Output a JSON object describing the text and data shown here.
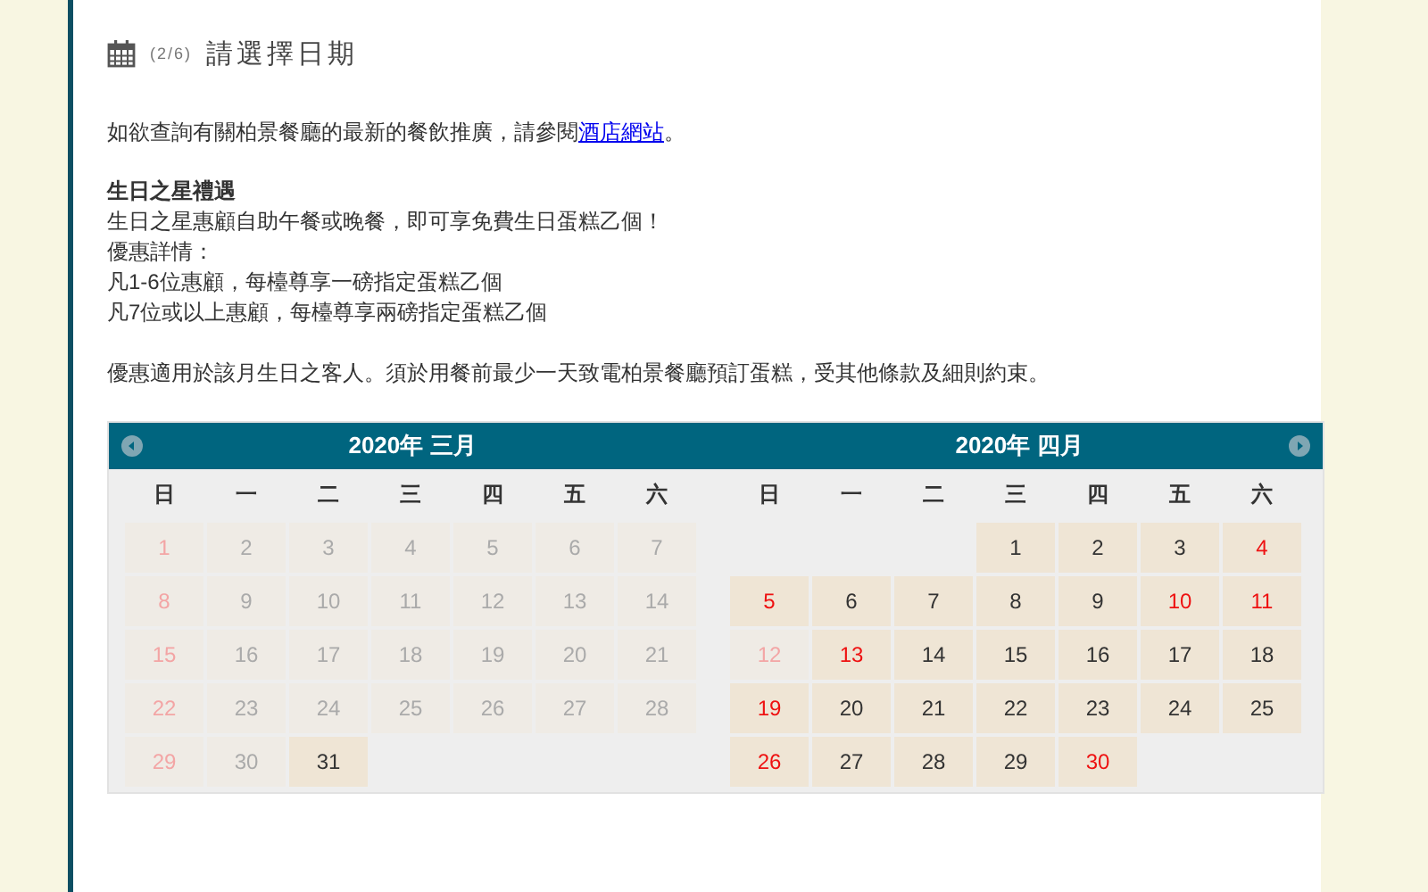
{
  "header": {
    "step": "(2/6)",
    "title": "請選擇日期"
  },
  "intro": {
    "before": "如欲查詢有關柏景餐廳的最新的餐飲推廣，請參閱",
    "link": "酒店網站",
    "after": "。"
  },
  "offer": {
    "heading": "生日之星禮遇",
    "lines": [
      "生日之星惠顧自助午餐或晚餐，即可享免費生日蛋糕乙個！",
      "優惠詳情：",
      "凡1-6位惠顧，每檯尊享一磅指定蛋糕乙個",
      "凡7位或以上惠顧，每檯尊享兩磅指定蛋糕乙個"
    ]
  },
  "note": "優惠適用於該月生日之客人。須於用餐前最少一天致電柏景餐廳預訂蛋糕，受其他條款及細則約束。",
  "months": [
    {
      "title": "2020年 三月",
      "prev_arrow": true,
      "next_arrow": false,
      "weekdays": [
        "日",
        "一",
        "二",
        "三",
        "四",
        "五",
        "六"
      ],
      "weeks": [
        [
          {
            "day": "1",
            "disabled": true,
            "holiday": true
          },
          {
            "day": "2",
            "disabled": true,
            "holiday": false
          },
          {
            "day": "3",
            "disabled": true,
            "holiday": false
          },
          {
            "day": "4",
            "disabled": true,
            "holiday": false
          },
          {
            "day": "5",
            "disabled": true,
            "holiday": false
          },
          {
            "day": "6",
            "disabled": true,
            "holiday": false
          },
          {
            "day": "7",
            "disabled": true,
            "holiday": false
          }
        ],
        [
          {
            "day": "8",
            "disabled": true,
            "holiday": true
          },
          {
            "day": "9",
            "disabled": true,
            "holiday": false
          },
          {
            "day": "10",
            "disabled": true,
            "holiday": false
          },
          {
            "day": "11",
            "disabled": true,
            "holiday": false
          },
          {
            "day": "12",
            "disabled": true,
            "holiday": false
          },
          {
            "day": "13",
            "disabled": true,
            "holiday": false
          },
          {
            "day": "14",
            "disabled": true,
            "holiday": false
          }
        ],
        [
          {
            "day": "15",
            "disabled": true,
            "holiday": true
          },
          {
            "day": "16",
            "disabled": true,
            "holiday": false
          },
          {
            "day": "17",
            "disabled": true,
            "holiday": false
          },
          {
            "day": "18",
            "disabled": true,
            "holiday": false
          },
          {
            "day": "19",
            "disabled": true,
            "holiday": false
          },
          {
            "day": "20",
            "disabled": true,
            "holiday": false
          },
          {
            "day": "21",
            "disabled": true,
            "holiday": false
          }
        ],
        [
          {
            "day": "22",
            "disabled": true,
            "holiday": true
          },
          {
            "day": "23",
            "disabled": true,
            "holiday": false
          },
          {
            "day": "24",
            "disabled": true,
            "holiday": false
          },
          {
            "day": "25",
            "disabled": true,
            "holiday": false
          },
          {
            "day": "26",
            "disabled": true,
            "holiday": false
          },
          {
            "day": "27",
            "disabled": true,
            "holiday": false
          },
          {
            "day": "28",
            "disabled": true,
            "holiday": false
          }
        ],
        [
          {
            "day": "29",
            "disabled": true,
            "holiday": true
          },
          {
            "day": "30",
            "disabled": true,
            "holiday": false
          },
          {
            "day": "31",
            "disabled": false,
            "holiday": false
          },
          {
            "kind": "blank"
          },
          {
            "kind": "blank"
          },
          {
            "kind": "blank"
          },
          {
            "kind": "blank"
          }
        ]
      ]
    },
    {
      "title": "2020年 四月",
      "prev_arrow": false,
      "next_arrow": true,
      "weekdays": [
        "日",
        "一",
        "二",
        "三",
        "四",
        "五",
        "六"
      ],
      "weeks": [
        [
          {
            "kind": "blank"
          },
          {
            "kind": "blank"
          },
          {
            "kind": "blank"
          },
          {
            "day": "1",
            "disabled": false,
            "holiday": false
          },
          {
            "day": "2",
            "disabled": false,
            "holiday": false
          },
          {
            "day": "3",
            "disabled": false,
            "holiday": false
          },
          {
            "day": "4",
            "disabled": false,
            "holiday": true
          }
        ],
        [
          {
            "day": "5",
            "disabled": false,
            "holiday": true
          },
          {
            "day": "6",
            "disabled": false,
            "holiday": false
          },
          {
            "day": "7",
            "disabled": false,
            "holiday": false
          },
          {
            "day": "8",
            "disabled": false,
            "holiday": false
          },
          {
            "day": "9",
            "disabled": false,
            "holiday": false
          },
          {
            "day": "10",
            "disabled": false,
            "holiday": true
          },
          {
            "day": "11",
            "disabled": false,
            "holiday": true
          }
        ],
        [
          {
            "day": "12",
            "disabled": true,
            "holiday": true
          },
          {
            "day": "13",
            "disabled": false,
            "holiday": true
          },
          {
            "day": "14",
            "disabled": false,
            "holiday": false
          },
          {
            "day": "15",
            "disabled": false,
            "holiday": false
          },
          {
            "day": "16",
            "disabled": false,
            "holiday": false
          },
          {
            "day": "17",
            "disabled": false,
            "holiday": false
          },
          {
            "day": "18",
            "disabled": false,
            "holiday": false
          }
        ],
        [
          {
            "day": "19",
            "disabled": false,
            "holiday": true
          },
          {
            "day": "20",
            "disabled": false,
            "holiday": false
          },
          {
            "day": "21",
            "disabled": false,
            "holiday": false
          },
          {
            "day": "22",
            "disabled": false,
            "holiday": false
          },
          {
            "day": "23",
            "disabled": false,
            "holiday": false
          },
          {
            "day": "24",
            "disabled": false,
            "holiday": false
          },
          {
            "day": "25",
            "disabled": false,
            "holiday": false
          }
        ],
        [
          {
            "day": "26",
            "disabled": false,
            "holiday": true
          },
          {
            "day": "27",
            "disabled": false,
            "holiday": false
          },
          {
            "day": "28",
            "disabled": false,
            "holiday": false
          },
          {
            "day": "29",
            "disabled": false,
            "holiday": false
          },
          {
            "day": "30",
            "disabled": false,
            "holiday": true
          },
          {
            "kind": "blank"
          },
          {
            "kind": "blank"
          }
        ]
      ]
    }
  ]
}
